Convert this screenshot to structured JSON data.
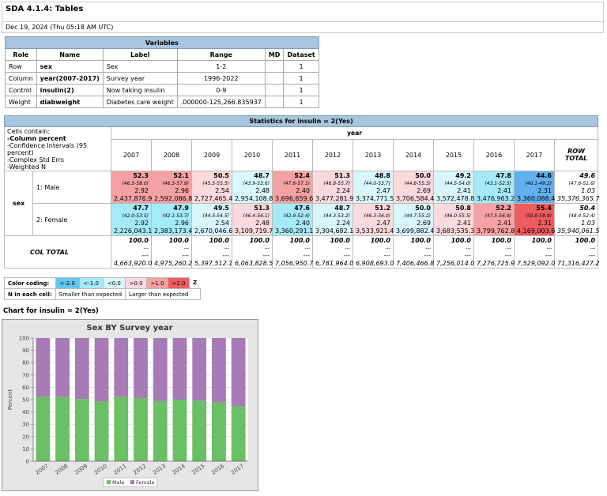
{
  "title": "SDA 4.1.4: Tables",
  "date": "Dec 19, 2024 (Thu 05:18 AM UTC)",
  "variables": {
    "header": "Variables",
    "columns": [
      "Role",
      "Name",
      "Label",
      "Range",
      "MD",
      "Dataset"
    ],
    "rows": [
      {
        "role": "Row",
        "name": "sex",
        "label": "Sex",
        "range": "1-2",
        "md": "",
        "dataset": "1"
      },
      {
        "role": "Column",
        "name": "year(2007-2017)",
        "label": "Survey year",
        "range": "1996-2022",
        "md": "",
        "dataset": "1"
      },
      {
        "role": "Control",
        "name": "insulin(2)",
        "label": "Now taking insulin",
        "range": "0-9",
        "md": "",
        "dataset": "1"
      },
      {
        "role": "Weight",
        "name": "diabweight",
        "label": "Diabetes care weight",
        "range": ".000000-125,266.835937",
        "md": "",
        "dataset": "1"
      }
    ]
  },
  "stats": {
    "header": "Statistics for insulin = 2(Yes)",
    "cells_contain": [
      "Cells contain:",
      "-Column percent",
      "-Confidence Intervals (95 percent)",
      "-Complex Std Errs",
      "-Weighted N"
    ],
    "year_label": "year",
    "row_var_label": "sex",
    "years": [
      "2007",
      "2008",
      "2009",
      "2010",
      "2011",
      "2012",
      "2013",
      "2014",
      "2015",
      "2016",
      "2017"
    ],
    "row_total_label": "ROW TOTAL",
    "col_total_label": "COL TOTAL",
    "colors": {
      "neg2": "#65c8f2",
      "neg1": "#a6e9f8",
      "neg0": "#d8f6fc",
      "pos0": "#fcd9dc",
      "pos1": "#f6a1a4",
      "pos2": "#ee5c5f",
      "dark": "#5fb0ee"
    },
    "rows": [
      {
        "label": "1: Male",
        "cells": [
          {
            "pct": "52.3",
            "ci": "(46.5-58.0)",
            "se": "2.92",
            "n": "2,437,876.9",
            "color": "pos1"
          },
          {
            "pct": "52.1",
            "ci": "(46.3-57.9)",
            "se": "2.96",
            "n": "2,592,086.8",
            "color": "pos1"
          },
          {
            "pct": "50.5",
            "ci": "(45.5-55.5)",
            "se": "2.54",
            "n": "2,727,465.4",
            "color": "pos0"
          },
          {
            "pct": "48.7",
            "ci": "(43.9-53.6)",
            "se": "2.48",
            "n": "2,954,108.8",
            "color": "neg0"
          },
          {
            "pct": "52.4",
            "ci": "(47.6-57.1)",
            "se": "2.40",
            "n": "3,696,659.6",
            "color": "pos1"
          },
          {
            "pct": "51.3",
            "ci": "(46.8-55.7)",
            "se": "2.24",
            "n": "3,477,281.9",
            "color": "pos0"
          },
          {
            "pct": "48.8",
            "ci": "(44.0-53.7)",
            "se": "2.47",
            "n": "3,374,771.5",
            "color": "neg0"
          },
          {
            "pct": "50.0",
            "ci": "(44.8-55.3)",
            "se": "2.69",
            "n": "3,706,584.4",
            "color": "pos0"
          },
          {
            "pct": "49.2",
            "ci": "(44.5-54.0)",
            "se": "2.41",
            "n": "3,572,478.8",
            "color": "neg0"
          },
          {
            "pct": "47.8",
            "ci": "(43.1-52.5)",
            "se": "2.41",
            "n": "3,476,963.2",
            "color": "neg1"
          },
          {
            "pct": "44.6",
            "ci": "(40.1-49.2)",
            "se": "2.31",
            "n": "3,360,088.4",
            "color": "dark"
          }
        ],
        "total": {
          "pct": "49.6",
          "ci": "(47.6-51.6)",
          "se": "1.03",
          "n": "35,376,365.7"
        }
      },
      {
        "label": "2: Female",
        "cells": [
          {
            "pct": "47.7",
            "ci": "(42.0-53.5)",
            "se": "2.92",
            "n": "2,226,043.1",
            "color": "neg1"
          },
          {
            "pct": "47.9",
            "ci": "(42.1-53.7)",
            "se": "2.96",
            "n": "2,383,173.4",
            "color": "neg1"
          },
          {
            "pct": "49.5",
            "ci": "(44.5-54.5)",
            "se": "2.54",
            "n": "2,670,046.6",
            "color": "neg0"
          },
          {
            "pct": "51.3",
            "ci": "(46.4-56.1)",
            "se": "2.48",
            "n": "3,109,719.7",
            "color": "pos0"
          },
          {
            "pct": "47.6",
            "ci": "(42.9-52.4)",
            "se": "2.40",
            "n": "3,360,291.1",
            "color": "neg1"
          },
          {
            "pct": "48.7",
            "ci": "(44.3-53.2)",
            "se": "2.24",
            "n": "3,304,682.1",
            "color": "neg0"
          },
          {
            "pct": "51.2",
            "ci": "(46.3-56.0)",
            "se": "2.47",
            "n": "3,533,921.4",
            "color": "pos0"
          },
          {
            "pct": "50.0",
            "ci": "(44.7-55.2)",
            "se": "2.69",
            "n": "3,699,882.4",
            "color": "neg0"
          },
          {
            "pct": "50.8",
            "ci": "(46.0-55.5)",
            "se": "2.41",
            "n": "3,683,535.3",
            "color": "pos0"
          },
          {
            "pct": "52.2",
            "ci": "(47.5-56.9)",
            "se": "2.41",
            "n": "3,799,762.8",
            "color": "pos1"
          },
          {
            "pct": "55.4",
            "ci": "(50.8-59.9)",
            "se": "2.31",
            "n": "4,169,003.6",
            "color": "pos2"
          }
        ],
        "total": {
          "pct": "50.4",
          "ci": "(48.4-52.4)",
          "se": "1.03",
          "n": "35,940,061.5"
        }
      }
    ],
    "col_totals": [
      {
        "pct": "100.0",
        "ci": "---",
        "se": "---",
        "n": "4,663,920.0"
      },
      {
        "pct": "100.0",
        "ci": "---",
        "se": "---",
        "n": "4,975,260.2"
      },
      {
        "pct": "100.0",
        "ci": "---",
        "se": "---",
        "n": "5,397,512.1"
      },
      {
        "pct": "100.0",
        "ci": "---",
        "se": "---",
        "n": "6,063,828.5"
      },
      {
        "pct": "100.0",
        "ci": "---",
        "se": "---",
        "n": "7,056,950.7"
      },
      {
        "pct": "100.0",
        "ci": "---",
        "se": "---",
        "n": "6,781,964.0"
      },
      {
        "pct": "100.0",
        "ci": "---",
        "se": "---",
        "n": "6,908,693.0"
      },
      {
        "pct": "100.0",
        "ci": "---",
        "se": "---",
        "n": "7,406,466.8"
      },
      {
        "pct": "100.0",
        "ci": "---",
        "se": "---",
        "n": "7,256,014.0"
      },
      {
        "pct": "100.0",
        "ci": "---",
        "se": "---",
        "n": "7,276,725.9"
      },
      {
        "pct": "100.0",
        "ci": "---",
        "se": "---",
        "n": "7,529,092.0"
      }
    ],
    "col_total_total": {
      "pct": "100.0",
      "ci": "---",
      "se": "---",
      "n": "71,316,427.2"
    }
  },
  "legend": {
    "color_coding_label": "Color coding:",
    "swatches": [
      {
        "text": "<-2.0",
        "color": "#65c8f2"
      },
      {
        "text": "<-1.0",
        "color": "#a6e9f8"
      },
      {
        "text": "<0.0",
        "color": "#d8f6fc"
      },
      {
        "text": ">0.0",
        "color": "#fcd9dc"
      },
      {
        "text": ">1.0",
        "color": "#f6a1a4"
      },
      {
        "text": ">2.0",
        "color": "#ee5c5f"
      }
    ],
    "z_label": "Z",
    "n_label": "N in each cell:",
    "smaller": "Smaller than expected",
    "larger": "Larger than expected"
  },
  "chart_title": "Chart for insulin = 2(Yes)",
  "chart_data": {
    "type": "bar",
    "stacked": true,
    "title": "Sex BY Survey year",
    "ylabel": "Percent",
    "xlabel": "",
    "ylim": [
      0,
      100
    ],
    "yticks": [
      0,
      10,
      20,
      30,
      40,
      50,
      60,
      70,
      80,
      90,
      100
    ],
    "categories": [
      "2007",
      "2008",
      "2009",
      "2010",
      "2011",
      "2012",
      "2013",
      "2014",
      "2015",
      "2016",
      "2017"
    ],
    "series": [
      {
        "name": "Male",
        "color": "#6bbf64",
        "values": [
          52.3,
          52.1,
          50.5,
          48.7,
          52.4,
          51.3,
          48.8,
          50.0,
          49.2,
          47.8,
          44.6
        ]
      },
      {
        "name": "Female",
        "color": "#a77bb5",
        "values": [
          47.7,
          47.9,
          49.5,
          51.3,
          47.6,
          48.7,
          51.2,
          50.0,
          50.8,
          52.2,
          55.4
        ]
      }
    ],
    "legend_position": "bottom"
  }
}
